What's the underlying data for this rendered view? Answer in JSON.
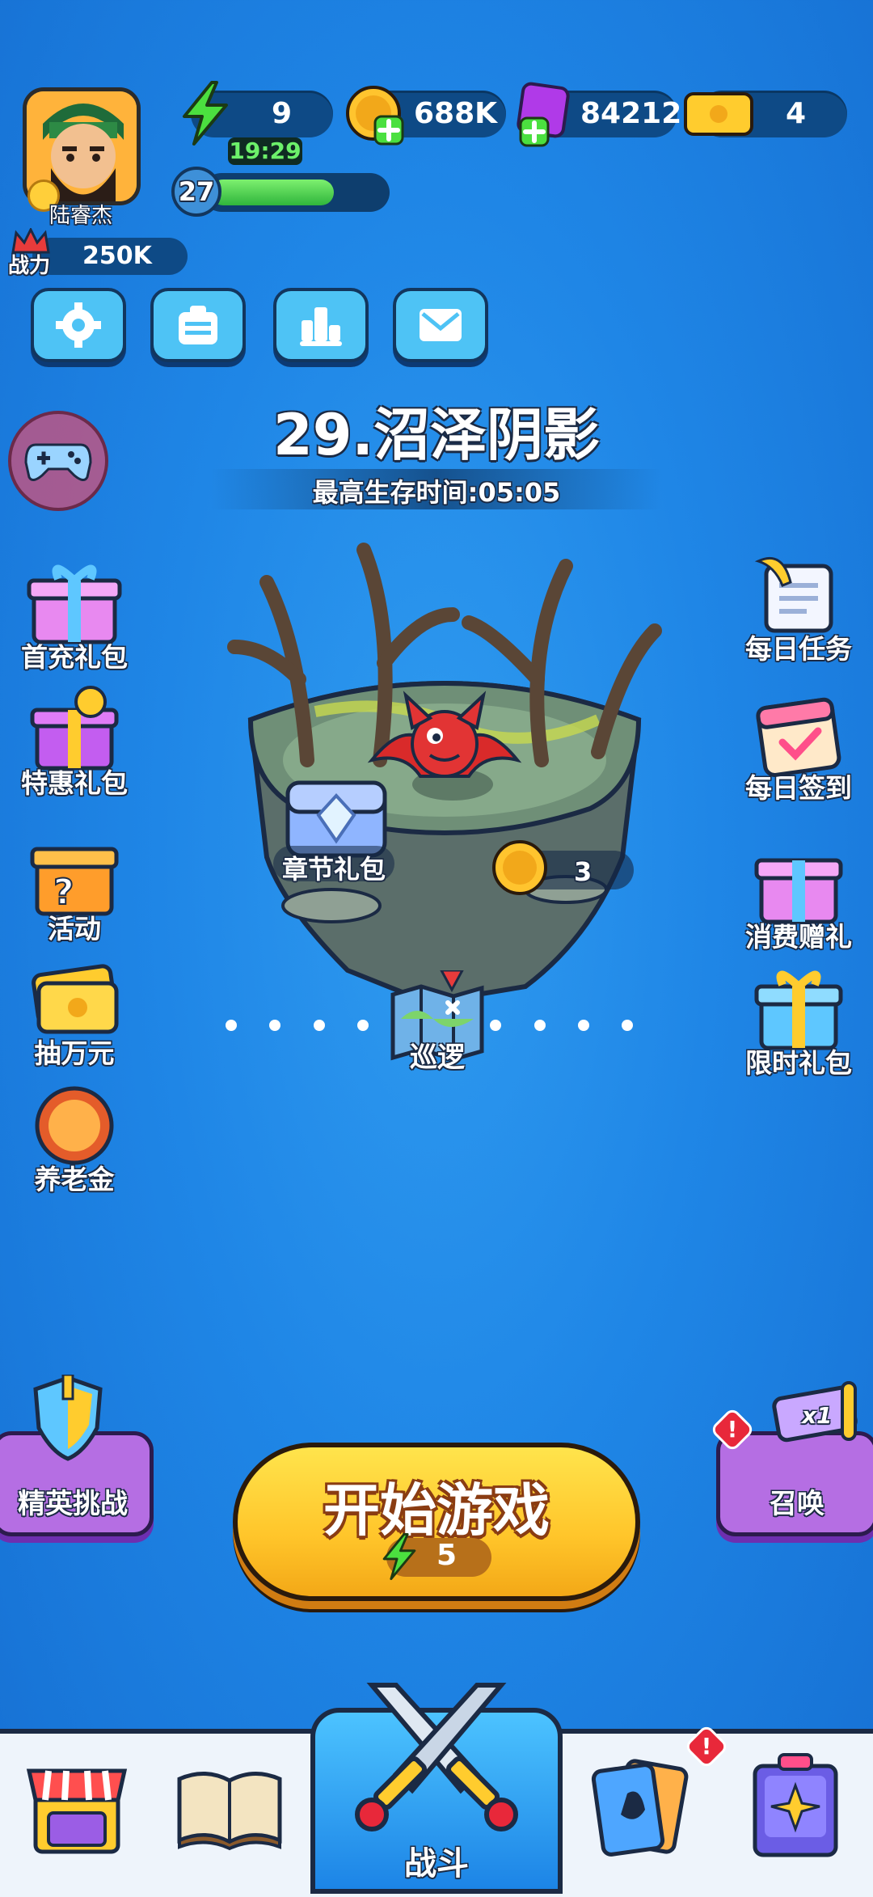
{
  "player": {
    "name": "陆睿杰",
    "level": "27",
    "level_progress": 0.72,
    "power_label": "战力",
    "power_value": "250K"
  },
  "resources": {
    "energy": "9",
    "energy_timer": "19:29",
    "gold": "688K",
    "gems": "84212",
    "tickets": "4"
  },
  "toolbar": {
    "icons": [
      "settings-icon",
      "notice-board-icon",
      "leaderboard-icon",
      "mail-icon"
    ]
  },
  "stage": {
    "title": "29.沼泽阴影",
    "best_time": "最高生存时间:05:05",
    "chest_label": "章节礼包",
    "coin_count": "3",
    "patrol_label": "巡逻"
  },
  "left_menu": [
    "首充礼包",
    "特惠礼包",
    "活动",
    "抽万元",
    "养老金"
  ],
  "right_menu": [
    "每日任务",
    "每日签到",
    "消费赠礼",
    "限时礼包"
  ],
  "elite": {
    "label": "精英挑战"
  },
  "summon": {
    "label": "召唤",
    "badge_text": "x1"
  },
  "play": {
    "label": "开始游戏",
    "cost": "5"
  },
  "nav": {
    "battle_label": "战斗",
    "items": [
      "shop-icon",
      "book-icon",
      "battle-icon",
      "cards-icon",
      "skill-book-icon"
    ]
  },
  "colors": {
    "accent_yellow": "#ffc52a",
    "purple": "#b56ee3",
    "bg_blue": "#1f86e6",
    "energy_green": "#3fd14a"
  }
}
